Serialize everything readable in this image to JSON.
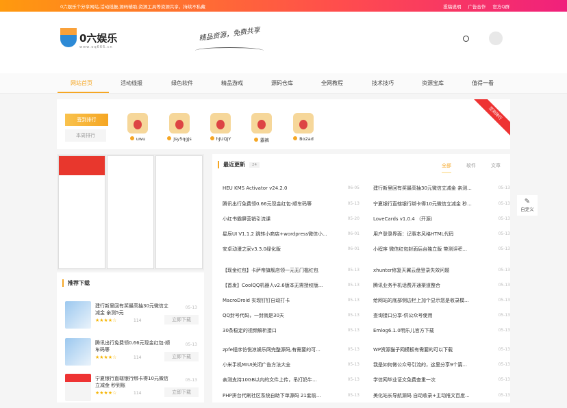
{
  "topbar": {
    "notice": "0六娱乐个分享网站,活动线报,源码辅助,资源工具等资源共享，持续不私藏",
    "links": [
      "投稿说明",
      "广告合作",
      "官方Q群"
    ]
  },
  "header": {
    "logo_name": "0六娱乐",
    "logo_url": "www.oq666.cn",
    "slogan": "精品资源，免费共享"
  },
  "nav": [
    "网站首页",
    "活动线报",
    "绿色软件",
    "精品游戏",
    "源码仓库",
    "全网教程",
    "技术技巧",
    "资源宝库",
    "值得一看"
  ],
  "rank": {
    "tabs": [
      "签到排行",
      "本周排行"
    ],
    "ribbon": "签到排行",
    "users": [
      "uwu",
      "jsy5qgjs",
      "hJUQjY",
      "霸裤",
      "Bo2ad"
    ]
  },
  "recommend": {
    "title": "推荐下载",
    "download_label": "立即下载",
    "items": [
      {
        "title": "建行新里回有奖最高抽30元微信立减金 亲测5元",
        "date": "05-13",
        "count": "114",
        "rating": 4
      },
      {
        "title": "腾讯出行免费领0.66元现金红包-顺车码等",
        "date": "05-13",
        "count": "114",
        "rating": 4
      },
      {
        "title": "宁夏银行直辖银行绑卡得10元微信立减金 秒到账",
        "date": "05-13",
        "count": "114",
        "rating": 4
      }
    ]
  },
  "main": {
    "title": "最近更新",
    "badge": "24",
    "tabs": [
      "全部",
      "软件",
      "文章"
    ],
    "left_posts": [
      {
        "t": "HEU KMS Activator v24.2.0",
        "d": "06-05"
      },
      {
        "t": "腾讯出行免费领0.66元现金红包-顺车码等",
        "d": "05-13"
      },
      {
        "t": "小红书霸屏营销引流课",
        "d": "05-20"
      },
      {
        "t": "星辰UI V1.1.2 跳转小商店+wordpress微信小...",
        "d": "06-01"
      },
      {
        "t": "安卓动漫之家v3.3.0绿化版",
        "d": "06-01"
      },
      {
        "t": "【现金红包】卡萨帝旗舰店领一元无门槛红包",
        "d": "05-13"
      },
      {
        "t": "【首发】CoolQQ机器人v2.6版本无需授权版...",
        "d": "05-13"
      },
      {
        "t": "MacroDroid 实现钉钉自动打卡",
        "d": "05-13"
      },
      {
        "t": "QQ封号代码，一封就是30天",
        "d": "05-13"
      },
      {
        "t": "30条稳定的视频解析接口",
        "d": "05-13"
      },
      {
        "t": "zpfe程序仿悦凉娱乐网完整源码,有需要的可...",
        "d": "05-13"
      },
      {
        "t": "小米手机MIUI关闭广告方法大全",
        "d": "05-13"
      },
      {
        "t": "亲测支持10GB以内的文件上传，吊打奶牛...",
        "d": "05-13"
      },
      {
        "t": "PHP拼台代刷社区系统自助下单源码 21套前...",
        "d": "05-13"
      }
    ],
    "right_posts": [
      {
        "t": "建行新里回有奖最高抽30元微信立减金 亲测...",
        "d": "05-13"
      },
      {
        "t": "宁夏银行直辖银行绑卡得10元微信立减金 秒...",
        "d": "05-13"
      },
      {
        "t": "LoveCards v1.0.4 （开源）",
        "d": "05-13"
      },
      {
        "t": "用户登录界面：记事本风格HTML代码",
        "d": "05-13"
      },
      {
        "t": "小程序 微信红包封面后台独立版 带测评积...",
        "d": "05-13"
      },
      {
        "t": "xhunter修复天翼云盘登录失效问题",
        "d": "05-13"
      },
      {
        "t": "腾讯业务手机话费开通渠道整合",
        "d": "05-13"
      },
      {
        "t": "给网站的底部侧边栏上加个显示您是收录模...",
        "d": "05-13"
      },
      {
        "t": "查询接口分享-供公众号使用",
        "d": "05-13"
      },
      {
        "t": "Emlog6.1.0明乐儿官方下载",
        "d": "05-13"
      },
      {
        "t": "WP资源猫子网模板有需要的可以下载",
        "d": "05-13"
      },
      {
        "t": "我是如何做公众号引流的，这里分享9个篇...",
        "d": "05-13"
      },
      {
        "t": "学信网毕业证文免费查重一次",
        "d": "05-13"
      },
      {
        "t": "美化站长导航源码 自动收录+主动推文百度...",
        "d": "05-13"
      }
    ]
  },
  "float": {
    "label": "自定义"
  }
}
